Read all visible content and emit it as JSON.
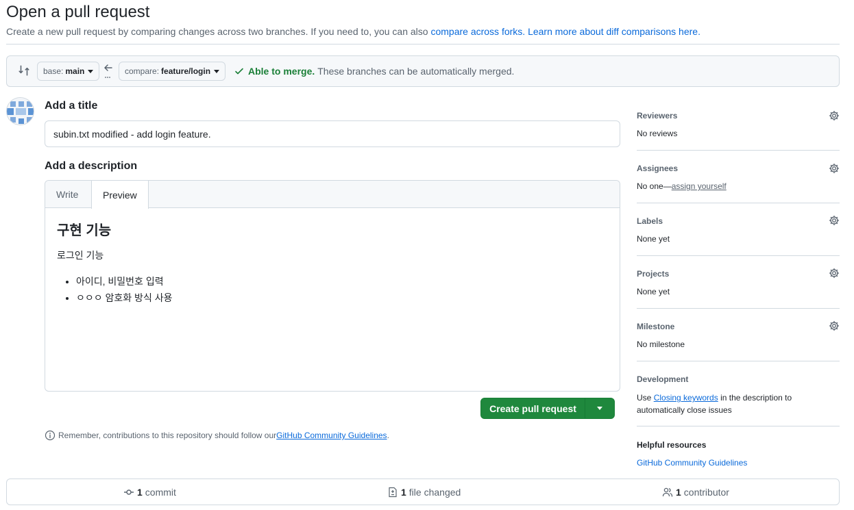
{
  "header": {
    "title": "Open a pull request",
    "subtitle_text": "Create a new pull request by comparing changes across two branches. If you need to, you can also ",
    "compare_forks_link": "compare across forks.",
    "learn_more_link": "Learn more about diff comparisons here."
  },
  "range": {
    "base_label": "base:",
    "base_branch": "main",
    "compare_label": "compare:",
    "compare_branch": "feature/login",
    "merge_ok": "Able to merge.",
    "merge_message": "These branches can be automatically merged."
  },
  "form": {
    "title_label": "Add a title",
    "title_value": "subin.txt modified - add login feature.",
    "description_label": "Add a description",
    "tab_write": "Write",
    "tab_preview": "Preview",
    "preview_heading": "구현 기능",
    "preview_paragraph": "로그인 기능",
    "preview_list": [
      "아이디, 비밀번호 입력",
      "ㅇㅇㅇ 암호화 방식 사용"
    ],
    "create_button": "Create pull request",
    "remember_text": "Remember, contributions to this repository should follow our ",
    "remember_link": "GitHub Community Guidelines",
    "remember_end": "."
  },
  "sidebar": {
    "reviewers_title": "Reviewers",
    "reviewers_value": "No reviews",
    "assignees_title": "Assignees",
    "assignees_value": "No one—",
    "assignees_link": "assign yourself",
    "labels_title": "Labels",
    "labels_value": "None yet",
    "projects_title": "Projects",
    "projects_value": "None yet",
    "milestone_title": "Milestone",
    "milestone_value": "No milestone",
    "development_title": "Development",
    "development_pre": "Use ",
    "development_link": "Closing keywords",
    "development_post": " in the description to automatically close issues",
    "resources_title": "Helpful resources",
    "resources_link": "GitHub Community Guidelines"
  },
  "footer": {
    "commit_count": "1",
    "commit_label": "commit",
    "files_count": "1",
    "files_label": "file changed",
    "contrib_count": "1",
    "contrib_label": "contributor"
  },
  "colors": {
    "accent_link": "#0969da",
    "success": "#1a7f37",
    "primary_button": "#1f883d",
    "border": "#d1d9e0"
  }
}
